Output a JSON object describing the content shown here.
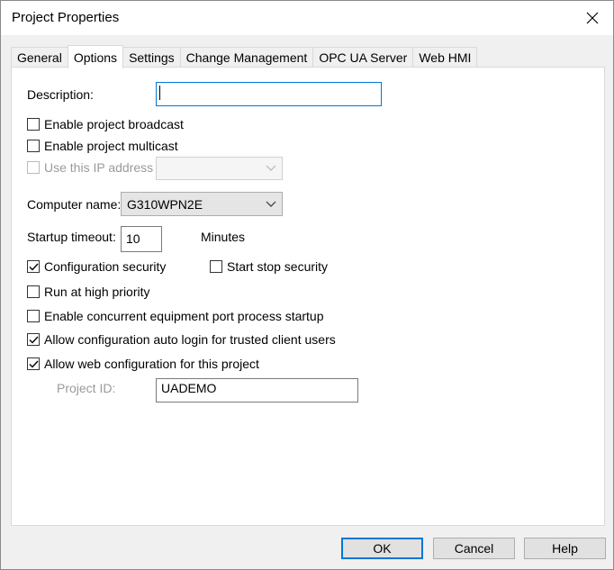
{
  "window": {
    "title": "Project Properties"
  },
  "tabs": [
    {
      "label": "General"
    },
    {
      "label": "Options"
    },
    {
      "label": "Settings"
    },
    {
      "label": "Change Management"
    },
    {
      "label": "OPC UA Server"
    },
    {
      "label": "Web HMI"
    }
  ],
  "active_tab": "Options",
  "options": {
    "description_label": "Description:",
    "description_value": "",
    "broadcast_label": "Enable project broadcast",
    "broadcast_checked": false,
    "multicast_label": "Enable project multicast",
    "multicast_checked": false,
    "ip_label": "Use this IP address",
    "ip_checked": false,
    "ip_value": "",
    "computer_name_label": "Computer name:",
    "computer_name_value": "G310WPN2E",
    "startup_timeout_label": "Startup timeout:",
    "startup_timeout_value": "10",
    "startup_timeout_unit": "Minutes",
    "config_security_label": "Configuration security",
    "config_security_checked": true,
    "start_stop_security_label": "Start stop security",
    "start_stop_security_checked": false,
    "high_priority_label": "Run at high priority",
    "high_priority_checked": false,
    "concurrent_label": "Enable concurrent equipment port process startup",
    "concurrent_checked": false,
    "auto_login_label": "Allow configuration auto login for trusted client users",
    "auto_login_checked": true,
    "web_config_label": "Allow web configuration for this project",
    "web_config_checked": true,
    "project_id_label": "Project ID:",
    "project_id_value": "UADEMO"
  },
  "buttons": {
    "ok": "OK",
    "cancel": "Cancel",
    "help": "Help"
  },
  "colors": {
    "accent": "#0078d7",
    "panel": "#ffffff",
    "chrome": "#f0f0f0"
  }
}
